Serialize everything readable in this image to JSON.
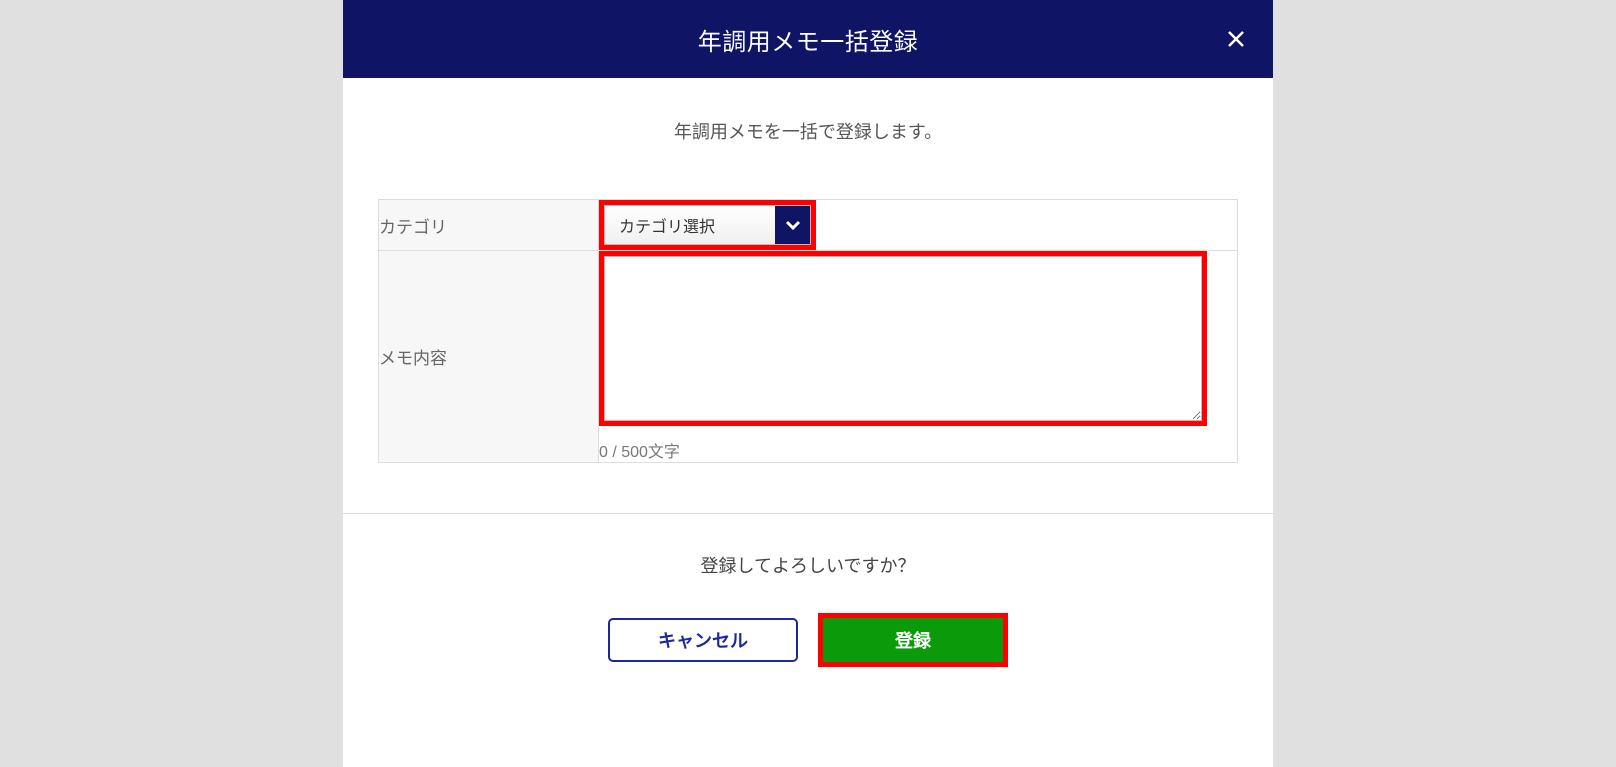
{
  "header": {
    "title": "年調用メモ一括登録"
  },
  "body": {
    "description": "年調用メモを一括で登録します。",
    "fields": {
      "category": {
        "label": "カテゴリ",
        "selected": "カテゴリ選択"
      },
      "memo": {
        "label": "メモ内容",
        "value": "",
        "counter": "0 / 500文字"
      }
    }
  },
  "footer": {
    "confirm_text": "登録してよろしいですか？",
    "cancel_label": "キャンセル",
    "submit_label": "登録"
  }
}
